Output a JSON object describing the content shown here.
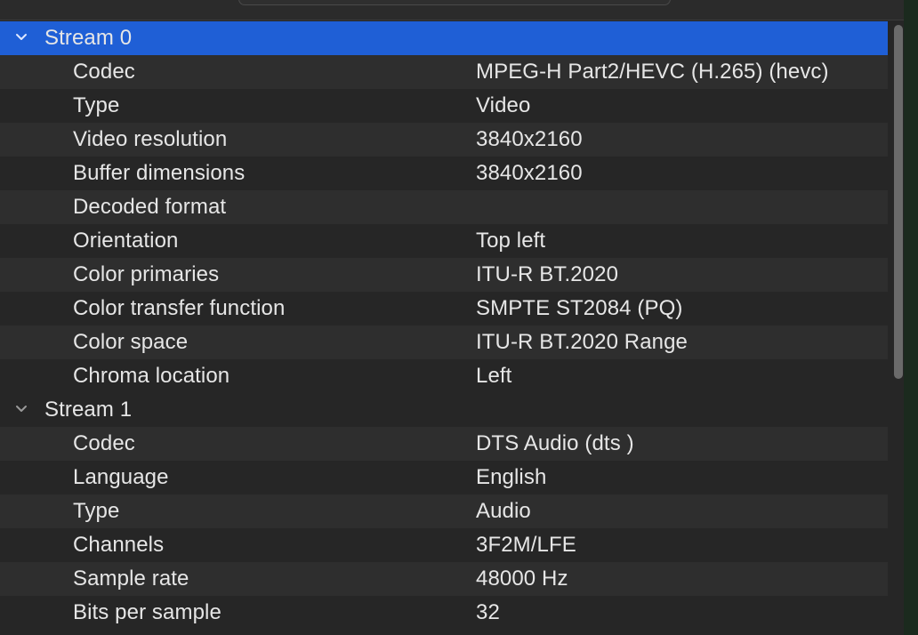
{
  "stream0": {
    "label": "Stream 0",
    "props": [
      {
        "key": "Codec",
        "value": "MPEG-H Part2/HEVC (H.265) (hevc)"
      },
      {
        "key": "Type",
        "value": "Video"
      },
      {
        "key": "Video resolution",
        "value": "3840x2160"
      },
      {
        "key": "Buffer dimensions",
        "value": "3840x2160"
      },
      {
        "key": "Decoded format",
        "value": ""
      },
      {
        "key": "Orientation",
        "value": "Top left"
      },
      {
        "key": "Color primaries",
        "value": "ITU-R BT.2020"
      },
      {
        "key": "Color transfer function",
        "value": "SMPTE ST2084 (PQ)"
      },
      {
        "key": "Color space",
        "value": "ITU-R BT.2020 Range"
      },
      {
        "key": "Chroma location",
        "value": "Left"
      }
    ]
  },
  "stream1": {
    "label": "Stream 1",
    "props": [
      {
        "key": "Codec",
        "value": "DTS Audio (dts )"
      },
      {
        "key": "Language",
        "value": "English"
      },
      {
        "key": "Type",
        "value": "Audio"
      },
      {
        "key": "Channels",
        "value": "3F2M/LFE"
      },
      {
        "key": "Sample rate",
        "value": "48000 Hz"
      },
      {
        "key": "Bits per sample",
        "value": "32"
      }
    ]
  },
  "icons": {
    "expand": "chevron-down-icon"
  },
  "colors": {
    "selection": "#1f5fd6",
    "text": "#e6e6e6",
    "row_alt": "#2e2e2e",
    "background": "#262626"
  }
}
